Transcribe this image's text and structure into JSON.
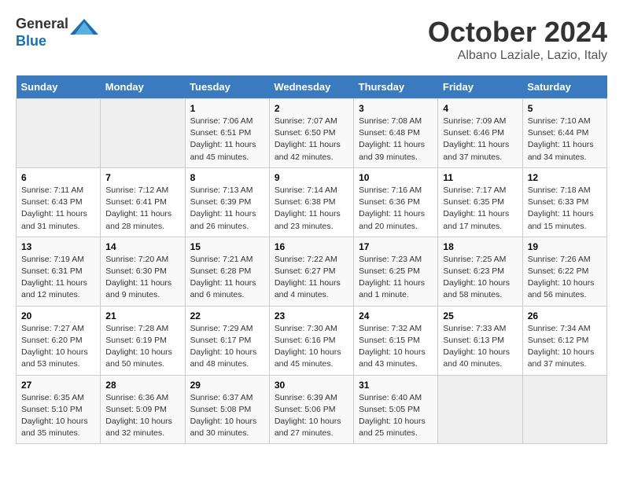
{
  "header": {
    "logo_line1": "General",
    "logo_line2": "Blue",
    "month": "October 2024",
    "location": "Albano Laziale, Lazio, Italy"
  },
  "days_of_week": [
    "Sunday",
    "Monday",
    "Tuesday",
    "Wednesday",
    "Thursday",
    "Friday",
    "Saturday"
  ],
  "weeks": [
    [
      {
        "day": "",
        "sunrise": "",
        "sunset": "",
        "daylight": ""
      },
      {
        "day": "",
        "sunrise": "",
        "sunset": "",
        "daylight": ""
      },
      {
        "day": "1",
        "sunrise": "Sunrise: 7:06 AM",
        "sunset": "Sunset: 6:51 PM",
        "daylight": "Daylight: 11 hours and 45 minutes."
      },
      {
        "day": "2",
        "sunrise": "Sunrise: 7:07 AM",
        "sunset": "Sunset: 6:50 PM",
        "daylight": "Daylight: 11 hours and 42 minutes."
      },
      {
        "day": "3",
        "sunrise": "Sunrise: 7:08 AM",
        "sunset": "Sunset: 6:48 PM",
        "daylight": "Daylight: 11 hours and 39 minutes."
      },
      {
        "day": "4",
        "sunrise": "Sunrise: 7:09 AM",
        "sunset": "Sunset: 6:46 PM",
        "daylight": "Daylight: 11 hours and 37 minutes."
      },
      {
        "day": "5",
        "sunrise": "Sunrise: 7:10 AM",
        "sunset": "Sunset: 6:44 PM",
        "daylight": "Daylight: 11 hours and 34 minutes."
      }
    ],
    [
      {
        "day": "6",
        "sunrise": "Sunrise: 7:11 AM",
        "sunset": "Sunset: 6:43 PM",
        "daylight": "Daylight: 11 hours and 31 minutes."
      },
      {
        "day": "7",
        "sunrise": "Sunrise: 7:12 AM",
        "sunset": "Sunset: 6:41 PM",
        "daylight": "Daylight: 11 hours and 28 minutes."
      },
      {
        "day": "8",
        "sunrise": "Sunrise: 7:13 AM",
        "sunset": "Sunset: 6:39 PM",
        "daylight": "Daylight: 11 hours and 26 minutes."
      },
      {
        "day": "9",
        "sunrise": "Sunrise: 7:14 AM",
        "sunset": "Sunset: 6:38 PM",
        "daylight": "Daylight: 11 hours and 23 minutes."
      },
      {
        "day": "10",
        "sunrise": "Sunrise: 7:16 AM",
        "sunset": "Sunset: 6:36 PM",
        "daylight": "Daylight: 11 hours and 20 minutes."
      },
      {
        "day": "11",
        "sunrise": "Sunrise: 7:17 AM",
        "sunset": "Sunset: 6:35 PM",
        "daylight": "Daylight: 11 hours and 17 minutes."
      },
      {
        "day": "12",
        "sunrise": "Sunrise: 7:18 AM",
        "sunset": "Sunset: 6:33 PM",
        "daylight": "Daylight: 11 hours and 15 minutes."
      }
    ],
    [
      {
        "day": "13",
        "sunrise": "Sunrise: 7:19 AM",
        "sunset": "Sunset: 6:31 PM",
        "daylight": "Daylight: 11 hours and 12 minutes."
      },
      {
        "day": "14",
        "sunrise": "Sunrise: 7:20 AM",
        "sunset": "Sunset: 6:30 PM",
        "daylight": "Daylight: 11 hours and 9 minutes."
      },
      {
        "day": "15",
        "sunrise": "Sunrise: 7:21 AM",
        "sunset": "Sunset: 6:28 PM",
        "daylight": "Daylight: 11 hours and 6 minutes."
      },
      {
        "day": "16",
        "sunrise": "Sunrise: 7:22 AM",
        "sunset": "Sunset: 6:27 PM",
        "daylight": "Daylight: 11 hours and 4 minutes."
      },
      {
        "day": "17",
        "sunrise": "Sunrise: 7:23 AM",
        "sunset": "Sunset: 6:25 PM",
        "daylight": "Daylight: 11 hours and 1 minute."
      },
      {
        "day": "18",
        "sunrise": "Sunrise: 7:25 AM",
        "sunset": "Sunset: 6:23 PM",
        "daylight": "Daylight: 10 hours and 58 minutes."
      },
      {
        "day": "19",
        "sunrise": "Sunrise: 7:26 AM",
        "sunset": "Sunset: 6:22 PM",
        "daylight": "Daylight: 10 hours and 56 minutes."
      }
    ],
    [
      {
        "day": "20",
        "sunrise": "Sunrise: 7:27 AM",
        "sunset": "Sunset: 6:20 PM",
        "daylight": "Daylight: 10 hours and 53 minutes."
      },
      {
        "day": "21",
        "sunrise": "Sunrise: 7:28 AM",
        "sunset": "Sunset: 6:19 PM",
        "daylight": "Daylight: 10 hours and 50 minutes."
      },
      {
        "day": "22",
        "sunrise": "Sunrise: 7:29 AM",
        "sunset": "Sunset: 6:17 PM",
        "daylight": "Daylight: 10 hours and 48 minutes."
      },
      {
        "day": "23",
        "sunrise": "Sunrise: 7:30 AM",
        "sunset": "Sunset: 6:16 PM",
        "daylight": "Daylight: 10 hours and 45 minutes."
      },
      {
        "day": "24",
        "sunrise": "Sunrise: 7:32 AM",
        "sunset": "Sunset: 6:15 PM",
        "daylight": "Daylight: 10 hours and 43 minutes."
      },
      {
        "day": "25",
        "sunrise": "Sunrise: 7:33 AM",
        "sunset": "Sunset: 6:13 PM",
        "daylight": "Daylight: 10 hours and 40 minutes."
      },
      {
        "day": "26",
        "sunrise": "Sunrise: 7:34 AM",
        "sunset": "Sunset: 6:12 PM",
        "daylight": "Daylight: 10 hours and 37 minutes."
      }
    ],
    [
      {
        "day": "27",
        "sunrise": "Sunrise: 6:35 AM",
        "sunset": "Sunset: 5:10 PM",
        "daylight": "Daylight: 10 hours and 35 minutes."
      },
      {
        "day": "28",
        "sunrise": "Sunrise: 6:36 AM",
        "sunset": "Sunset: 5:09 PM",
        "daylight": "Daylight: 10 hours and 32 minutes."
      },
      {
        "day": "29",
        "sunrise": "Sunrise: 6:37 AM",
        "sunset": "Sunset: 5:08 PM",
        "daylight": "Daylight: 10 hours and 30 minutes."
      },
      {
        "day": "30",
        "sunrise": "Sunrise: 6:39 AM",
        "sunset": "Sunset: 5:06 PM",
        "daylight": "Daylight: 10 hours and 27 minutes."
      },
      {
        "day": "31",
        "sunrise": "Sunrise: 6:40 AM",
        "sunset": "Sunset: 5:05 PM",
        "daylight": "Daylight: 10 hours and 25 minutes."
      },
      {
        "day": "",
        "sunrise": "",
        "sunset": "",
        "daylight": ""
      },
      {
        "day": "",
        "sunrise": "",
        "sunset": "",
        "daylight": ""
      }
    ]
  ]
}
